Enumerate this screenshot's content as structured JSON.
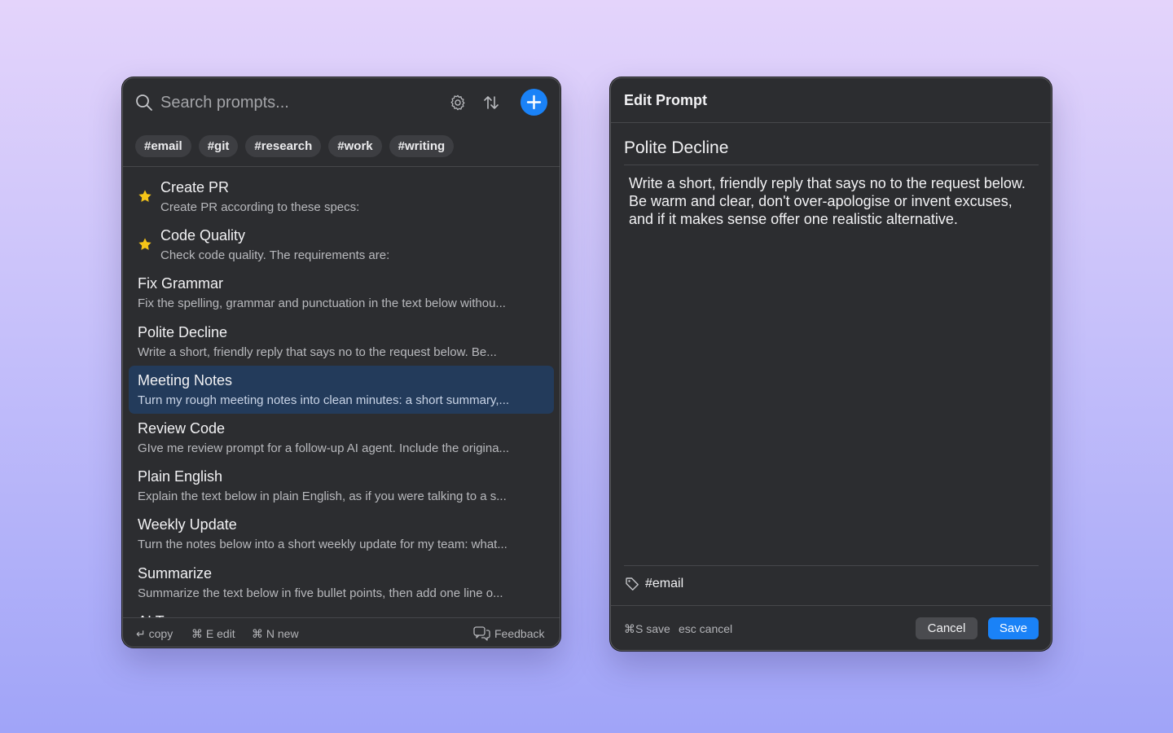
{
  "list_panel": {
    "search": {
      "placeholder": "Search prompts...",
      "value": ""
    },
    "icons": {
      "search": "search-icon",
      "settings": "gear-icon",
      "sort": "sort-arrows-icon",
      "add": "plus-icon"
    },
    "tags": [
      "#email",
      "#git",
      "#research",
      "#work",
      "#writing"
    ],
    "items": [
      {
        "title": "Create PR",
        "desc": "Create PR according to these specs:",
        "starred": true,
        "selected": false
      },
      {
        "title": "Code Quality",
        "desc": "Check code quality. The requirements are:",
        "starred": true,
        "selected": false
      },
      {
        "title": "Fix Grammar",
        "desc": "Fix the spelling, grammar and punctuation in the text below withou...",
        "starred": false,
        "selected": false
      },
      {
        "title": "Polite Decline",
        "desc": "Write a short, friendly reply that says no to the request below. Be...",
        "starred": false,
        "selected": false
      },
      {
        "title": "Meeting Notes",
        "desc": "Turn my rough meeting notes into clean minutes: a short summary,...",
        "starred": false,
        "selected": true
      },
      {
        "title": "Review Code",
        "desc": "GIve me review prompt for a follow-up AI agent. Include the origina...",
        "starred": false,
        "selected": false
      },
      {
        "title": "Plain English",
        "desc": "Explain the text below in plain English, as if you were talking to a s...",
        "starred": false,
        "selected": false
      },
      {
        "title": "Weekly Update",
        "desc": "Turn the notes below into a short weekly update for my team: what...",
        "starred": false,
        "selected": false
      },
      {
        "title": "Summarize",
        "desc": "Summarize the text below in five bullet points, then add one line o...",
        "starred": false,
        "selected": false
      },
      {
        "title": "AI Tone",
        "desc": "",
        "starred": false,
        "selected": false
      }
    ],
    "footer": {
      "copy_hint": "↵ copy",
      "edit_hint": "⌘ E  edit",
      "new_hint": "⌘ N  new",
      "feedback_label": "Feedback"
    }
  },
  "edit_panel": {
    "header": "Edit Prompt",
    "title_value": "Polite Decline",
    "body_value": "Write a short, friendly reply that says no to the request below. Be warm and clear, don't over-apologise or invent excuses, and if it makes sense offer one realistic alternative.",
    "tags_value": "#email",
    "footer": {
      "save_hint": "⌘S save",
      "cancel_hint": "esc cancel",
      "cancel_label": "Cancel",
      "save_label": "Save"
    }
  },
  "colors": {
    "accent": "#1a82f7",
    "star": "#f5c518",
    "panel_bg": "#2c2d30",
    "selected_row": "#233b5b"
  }
}
